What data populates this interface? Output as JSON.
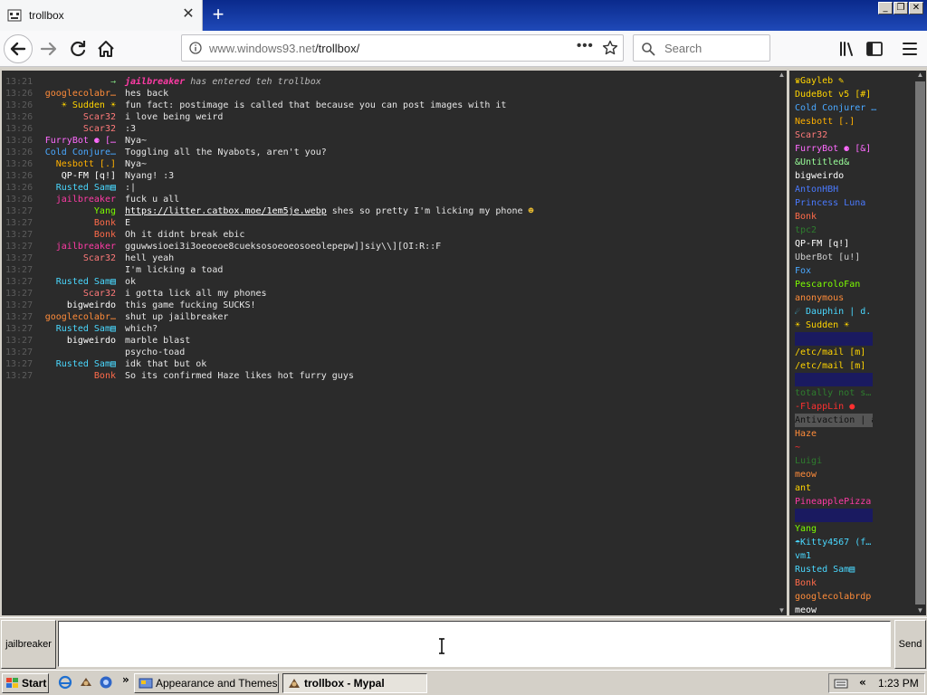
{
  "browser": {
    "tab_title": "trollbox",
    "tab_close": "✕",
    "new_tab": "+",
    "url_host": "www.windows93.net",
    "url_path": "/trollbox/",
    "search_placeholder": "Search",
    "page_actions": "•••",
    "window_minimize": "_",
    "window_restore": "❐",
    "window_close": "✕"
  },
  "chat": {
    "messages": [
      {
        "time": "13:21",
        "nick": "→",
        "nick_color": "#7cd27c",
        "text": "",
        "system": true,
        "sys_nick": "jailbreaker",
        "sys_text": " has entered teh trollbox"
      },
      {
        "time": "13:26",
        "nick": "googlecolabr…",
        "nick_color": "#ff8c3a",
        "text": "hes back"
      },
      {
        "time": "13:26",
        "nick": "☀ Sudden ☀",
        "nick_color": "#ffd400",
        "text": "fun fact: postimage is called that because you can post images with it"
      },
      {
        "time": "13:26",
        "nick": "Scar32",
        "nick_color": "#ff7a7a",
        "text": "i love being weird"
      },
      {
        "time": "13:26",
        "nick": "Scar32",
        "nick_color": "#ff7a7a",
        "text": ":3"
      },
      {
        "time": "13:26",
        "nick": "FurryBot ⚈ […",
        "nick_color": "#ff6bff",
        "text": "Nya~"
      },
      {
        "time": "13:26",
        "nick": "Cold Conjure…",
        "nick_color": "#4aa8ff",
        "text": "Toggling all the Nyabots, aren't you?"
      },
      {
        "time": "13:26",
        "nick": "Nesbott [.]",
        "nick_color": "#ffb000",
        "text": "Nya~"
      },
      {
        "time": "13:26",
        "nick": "QP-FM [q!]",
        "nick_color": "#ffffff",
        "text": "Nyang! :3"
      },
      {
        "time": "13:26",
        "nick": "Rusted Sam▤",
        "nick_color": "#4ad8ff",
        "text": ":|"
      },
      {
        "time": "13:26",
        "nick": "jailbreaker",
        "nick_color": "#ff3ba6",
        "text": "fuck u all"
      },
      {
        "time": "13:27",
        "nick": "Yang",
        "nick_color": "#7cfc00",
        "text": "",
        "link": "https://litter.catbox.moe/1em5je.webp",
        "after": " shes so pretty  I'm licking my phone ",
        "emoji": "☻"
      },
      {
        "time": "13:27",
        "nick": "Bonk",
        "nick_color": "#ff6b4a",
        "text": "E"
      },
      {
        "time": "13:27",
        "nick": "Bonk",
        "nick_color": "#ff6b4a",
        "text": "Oh it didnt break ebic"
      },
      {
        "time": "13:27",
        "nick": "jailbreaker",
        "nick_color": "#ff3ba6",
        "text": "gguwwsioei3i3oeoeoe8cueksosoeoeosoeolepepw]]siy\\\\][OI:R::F"
      },
      {
        "time": "13:27",
        "nick": "Scar32",
        "nick_color": "#ff7a7a",
        "text": "hell yeah"
      },
      {
        "time": "13:27",
        "nick": "",
        "nick_color": "#2a2ad8",
        "text": "I'm licking a toad"
      },
      {
        "time": "13:27",
        "nick": "Rusted Sam▤",
        "nick_color": "#4ad8ff",
        "text": "ok"
      },
      {
        "time": "13:27",
        "nick": "Scar32",
        "nick_color": "#ff7a7a",
        "text": "i gotta lick all my phones"
      },
      {
        "time": "13:27",
        "nick": "bigweirdo",
        "nick_color": "#ffffff",
        "text": "this game fucking SUCKS!"
      },
      {
        "time": "13:27",
        "nick": "googlecolabr…",
        "nick_color": "#ff8c3a",
        "text": "shut up jailbreaker"
      },
      {
        "time": "13:27",
        "nick": "Rusted Sam▤",
        "nick_color": "#4ad8ff",
        "text": "which?"
      },
      {
        "time": "13:27",
        "nick": "bigweirdo",
        "nick_color": "#ffffff",
        "text": "marble blast"
      },
      {
        "time": "13:27",
        "nick": "",
        "nick_color": "#2a2ad8",
        "text": "psycho-toad"
      },
      {
        "time": "13:27",
        "nick": "Rusted Sam▤",
        "nick_color": "#4ad8ff",
        "text": "idk that but ok"
      },
      {
        "time": "13:27",
        "nick": "Bonk",
        "nick_color": "#ff6b4a",
        "text": "So its confirmed Haze likes hot furry guys"
      }
    ],
    "scroll_up": "▲",
    "scroll_down": "▼"
  },
  "users": [
    {
      "name": "♛Gayleb ✎",
      "color": "#ffd400",
      "bg": ""
    },
    {
      "name": "DudeBot v5 [#]",
      "color": "#ffd400",
      "bg": ""
    },
    {
      "name": "Cold Conjurer …",
      "color": "#4aa8ff",
      "bg": ""
    },
    {
      "name": "Nesbott [.]",
      "color": "#ffb000",
      "bg": ""
    },
    {
      "name": "Scar32",
      "color": "#ff7a7a",
      "bg": ""
    },
    {
      "name": "FurryBot ⚈ [&]",
      "color": "#ff6bff",
      "bg": ""
    },
    {
      "name": "&Untitled&",
      "color": "#9aff9a",
      "bg": ""
    },
    {
      "name": "bigweirdo",
      "color": "#ffffff",
      "bg": ""
    },
    {
      "name": "AntonHBH",
      "color": "#4a7aff",
      "bg": ""
    },
    {
      "name": "Princess Luna",
      "color": "#4a7aff",
      "bg": ""
    },
    {
      "name": "Bonk",
      "color": "#ff6b4a",
      "bg": ""
    },
    {
      "name": "tpc2",
      "color": "#2e7d2e",
      "bg": ""
    },
    {
      "name": "QP-FM [q!]",
      "color": "#ffffff",
      "bg": ""
    },
    {
      "name": "UberBot [u!]",
      "color": "#cfcfcf",
      "bg": ""
    },
    {
      "name": "Fox",
      "color": "#4aa8ff",
      "bg": ""
    },
    {
      "name": "PescaroloFan",
      "color": "#7cfc00",
      "bg": ""
    },
    {
      "name": "anonymous",
      "color": "#ff8c3a",
      "bg": ""
    },
    {
      "name": "☄ Dauphin | d.",
      "color": "#4ad8ff",
      "bg": ""
    },
    {
      "name": "☀ Sudden ☀",
      "color": "#ffd400",
      "bg": ""
    },
    {
      "name": "",
      "color": "#2a2ad8",
      "bg": "#1a1a60"
    },
    {
      "name": "/etc/mail [m]",
      "color": "#ffd400",
      "bg": ""
    },
    {
      "name": "/etc/mail [m]",
      "color": "#ffd400",
      "bg": ""
    },
    {
      "name": "",
      "color": "#2a2ad8",
      "bg": "#1a1a60"
    },
    {
      "name": "totally not s…",
      "color": "#2e7d2e",
      "bg": ""
    },
    {
      "name": "-FlappLin ●",
      "color": "#ff3030",
      "bg": ""
    },
    {
      "name": "Antivaction | a…",
      "color": "#111111",
      "bg": "#555555"
    },
    {
      "name": "Haze",
      "color": "#ff8c3a",
      "bg": ""
    },
    {
      "name": "~",
      "color": "#ff3030",
      "bg": ""
    },
    {
      "name": "Luigi",
      "color": "#2e7d2e",
      "bg": ""
    },
    {
      "name": "meow",
      "color": "#ff8c3a",
      "bg": ""
    },
    {
      "name": "ant",
      "color": "#ffd400",
      "bg": ""
    },
    {
      "name": "PineapplePizza",
      "color": "#ff3ba6",
      "bg": ""
    },
    {
      "name": "",
      "color": "#2a2ad8",
      "bg": "#1a1a60"
    },
    {
      "name": "Yang",
      "color": "#7cfc00",
      "bg": ""
    },
    {
      "name": "☂Kitty4567 (f…",
      "color": "#4ad8ff",
      "bg": ""
    },
    {
      "name": "vm1",
      "color": "#4ad8ff",
      "bg": ""
    },
    {
      "name": "Rusted Sam▤",
      "color": "#4ad8ff",
      "bg": ""
    },
    {
      "name": "Bonk",
      "color": "#ff6b4a",
      "bg": ""
    },
    {
      "name": "googlecolabrdp",
      "color": "#ff8c3a",
      "bg": ""
    },
    {
      "name": "meow",
      "color": "#ffffff",
      "bg": ""
    }
  ],
  "input": {
    "nick_button": "jailbreaker",
    "send_button": "Send",
    "message_value": ""
  },
  "taskbar": {
    "start_label": "Start",
    "overflow": "»",
    "tasks": [
      {
        "label": "Appearance and Themes"
      },
      {
        "label": "trollbox - Mypal"
      }
    ],
    "tray_chevron": "«",
    "clock": "1:23 PM"
  }
}
